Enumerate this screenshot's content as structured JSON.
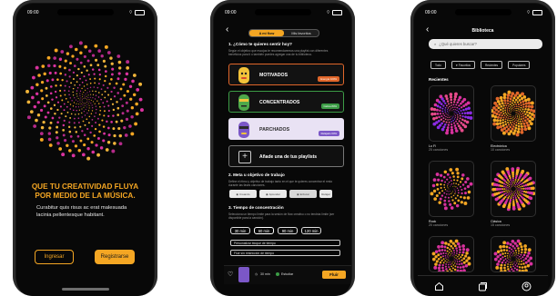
{
  "status_time": "09:00",
  "phone1": {
    "title": "QUE TU CREATIVIDAD FLUYA POR MEDIO DE LA MÚSICA.",
    "body": "Curabitur quis risus ac erat malesuada lacinia pellentesque habitant.",
    "login_label": "Ingresar",
    "register_label": "Registrarse"
  },
  "phone2": {
    "toggle": [
      "A mi flow",
      "Mis favoritos"
    ],
    "question1": "1. ¿Cómo te quieres sentir hoy?",
    "question1_desc": "Según el objetivo que escojas te recomendaremos una playlist con diferentes beneficios para ti o también puedes agregar una de tu biblioteca.",
    "moods": [
      {
        "label": "MOTIVADOS",
        "tag": "Energía 100%",
        "tag_color": "#e0662a"
      },
      {
        "label": "CONCENTRADOS",
        "tag": "Calma 80%",
        "tag_color": "#3c9c46"
      },
      {
        "label": "PARCHADOS",
        "tag": "Relajado 60%",
        "tag_color": "#7b57c7"
      },
      {
        "label": "Añade una de tus playlists",
        "tag": "",
        "tag_color": ""
      }
    ],
    "question2": "2. Meta u objetivo de trabajo",
    "question2_desc": "Define el ritmo y objetivo de trabajo tanto en el que te quieres concentrar el resto durante las fases canciones.",
    "goal_chips": [
      "Creando",
      "Aprender",
      "Enfocar",
      "Relajar"
    ],
    "question3": "3. Tiempo de concentración",
    "question3_desc": "Selecciona un tiempo límite para la sesión de flow creativo o no tendrás límite (ser disponible para la canción).",
    "times": [
      "30 min",
      "60 min",
      "90 min",
      "120 min"
    ],
    "selected_time": "60 min",
    "inputs": [
      "Personalizar bloque de tiempo",
      "Fluir sin restricción de tiempo"
    ],
    "player": {
      "time": "30 min",
      "state": "Estudiar",
      "cta": "Fluir"
    }
  },
  "phone3": {
    "title": "Biblioteca",
    "search_placeholder": "¿Qué quieres buscar?",
    "filters": [
      "Todo",
      "Favoritos",
      "Recientes",
      "Populares"
    ],
    "section": "Recientes",
    "cards": [
      {
        "name": "Lo Fi",
        "count": "25 canciones"
      },
      {
        "name": "Electrónica",
        "count": "10 canciones"
      },
      {
        "name": "Rock",
        "count": "20 canciones"
      },
      {
        "name": "Clásica",
        "count": "15 canciones"
      }
    ]
  },
  "colors": {
    "accent": "#f4a623",
    "magenta": "#d8329e",
    "background": "#080808"
  },
  "icons": [
    "back-arrow-icon",
    "wifi-icon",
    "battery-icon",
    "search-icon",
    "heart-icon",
    "plus-icon",
    "home-icon",
    "library-icon",
    "profile-icon",
    "clock-icon"
  ]
}
